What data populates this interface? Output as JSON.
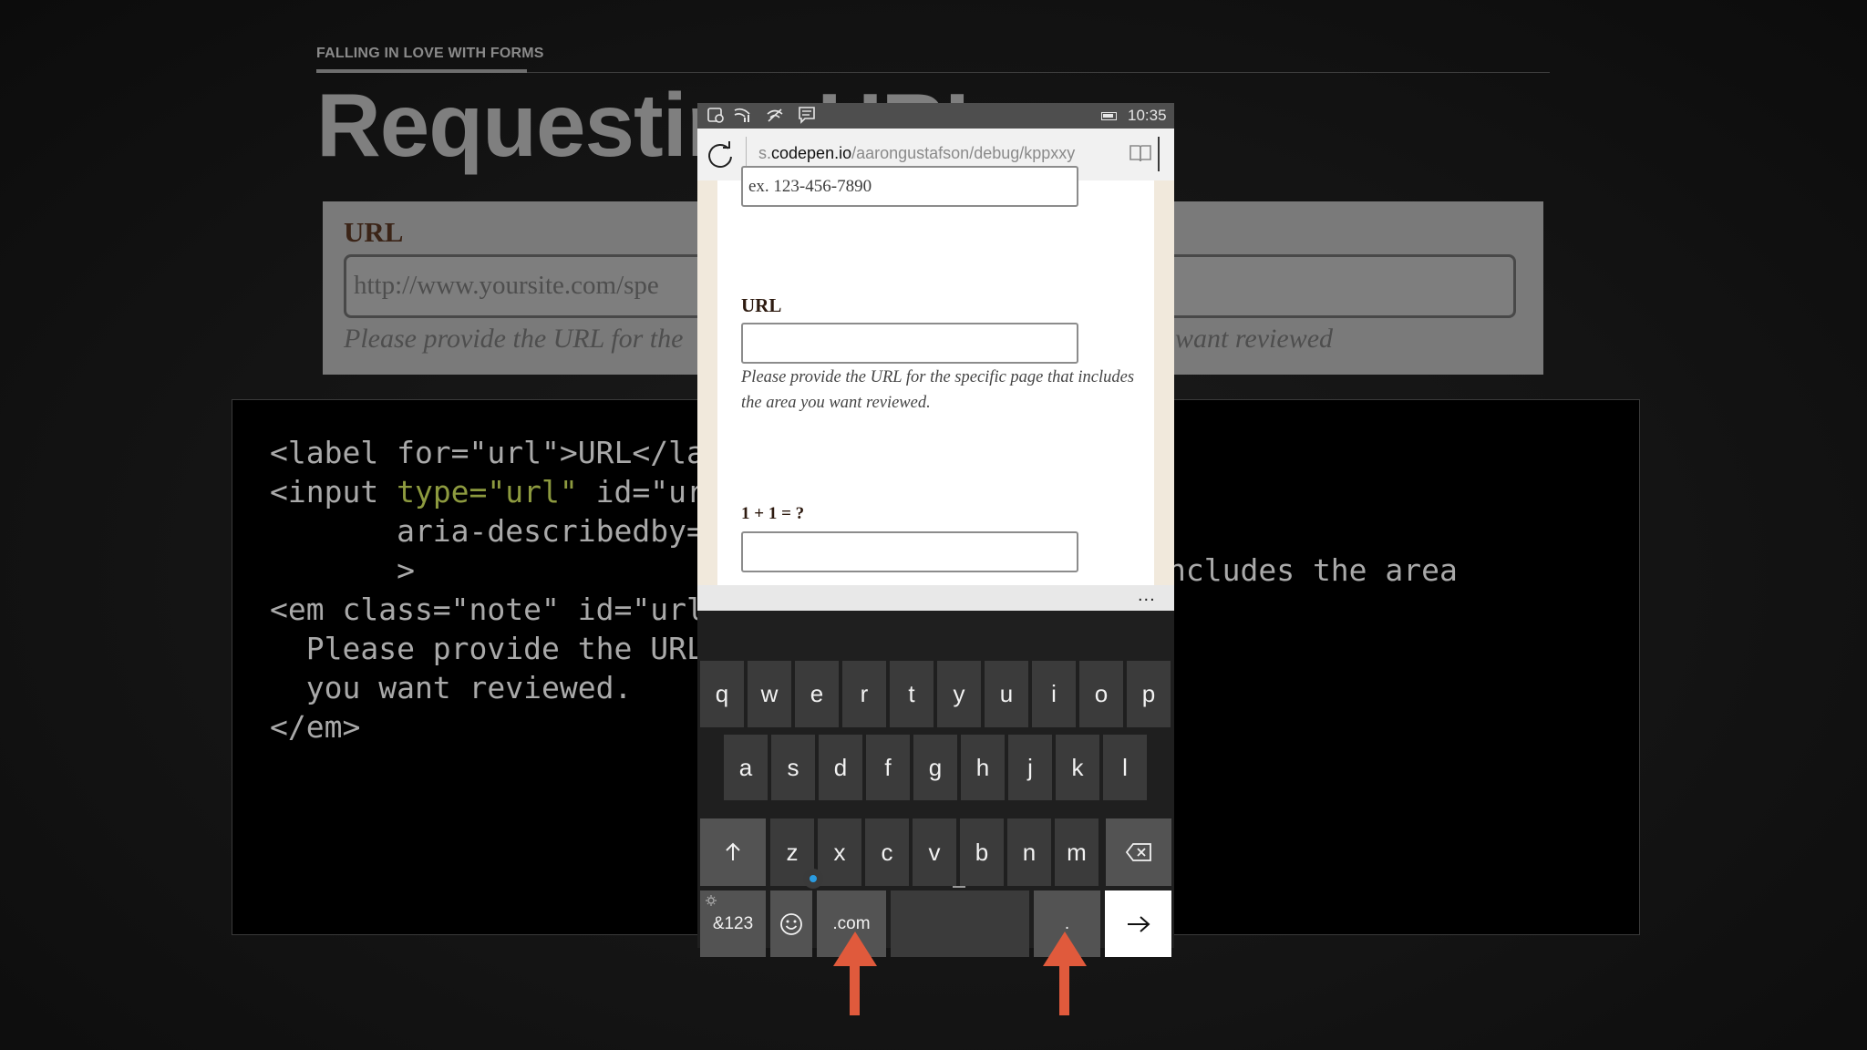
{
  "slide": {
    "kicker": "FALLING IN LOVE WITH FORMS",
    "title": "Requesting URLs"
  },
  "demo": {
    "label": "URL",
    "placeholder": "http://www.yoursite.com/spe",
    "note_left": "Please provide the URL for the",
    "note_right": "want reviewed"
  },
  "code": {
    "line1": "<label for=\"url\">URL</la",
    "line2_start": "<input ",
    "line2_attr": "type=\"url\"",
    "line2_end": " id=\"url",
    "line3": "       aria-describedby=\"",
    "line4": "       >",
    "line5": "<em class=\"note\" id=\"url-",
    "line6": "  Please provide the URL",
    "line6_right": "ncludes the area",
    "line7": "  you want reviewed.",
    "line8": "</em>"
  },
  "phone": {
    "status": {
      "time": "10:35"
    },
    "browser": {
      "url_prefix": "s.",
      "url_host": "codepen.io",
      "url_path": "/aarongustafson/debug/kppxxy"
    },
    "form": {
      "phone_placeholder": "ex. 123-456-7890",
      "url_label": "URL",
      "url_note": "Please provide the URL for the specific page that includes the area you want reviewed.",
      "math_label": "1 + 1 = ?"
    },
    "more": "...",
    "keyboard": {
      "row1": [
        "q",
        "w",
        "e",
        "r",
        "t",
        "y",
        "u",
        "i",
        "o",
        "p"
      ],
      "row2": [
        "a",
        "s",
        "d",
        "f",
        "g",
        "h",
        "j",
        "k",
        "l"
      ],
      "row3": [
        "z",
        "x",
        "c",
        "v",
        "b",
        "n",
        "m"
      ],
      "symbols": "&123",
      "dotcom": ".com",
      "period": "."
    }
  },
  "colors": {
    "accent_arrow": "#e05a3c",
    "code_attr": "#8d9a3f",
    "label_brown": "#2e1b10"
  }
}
